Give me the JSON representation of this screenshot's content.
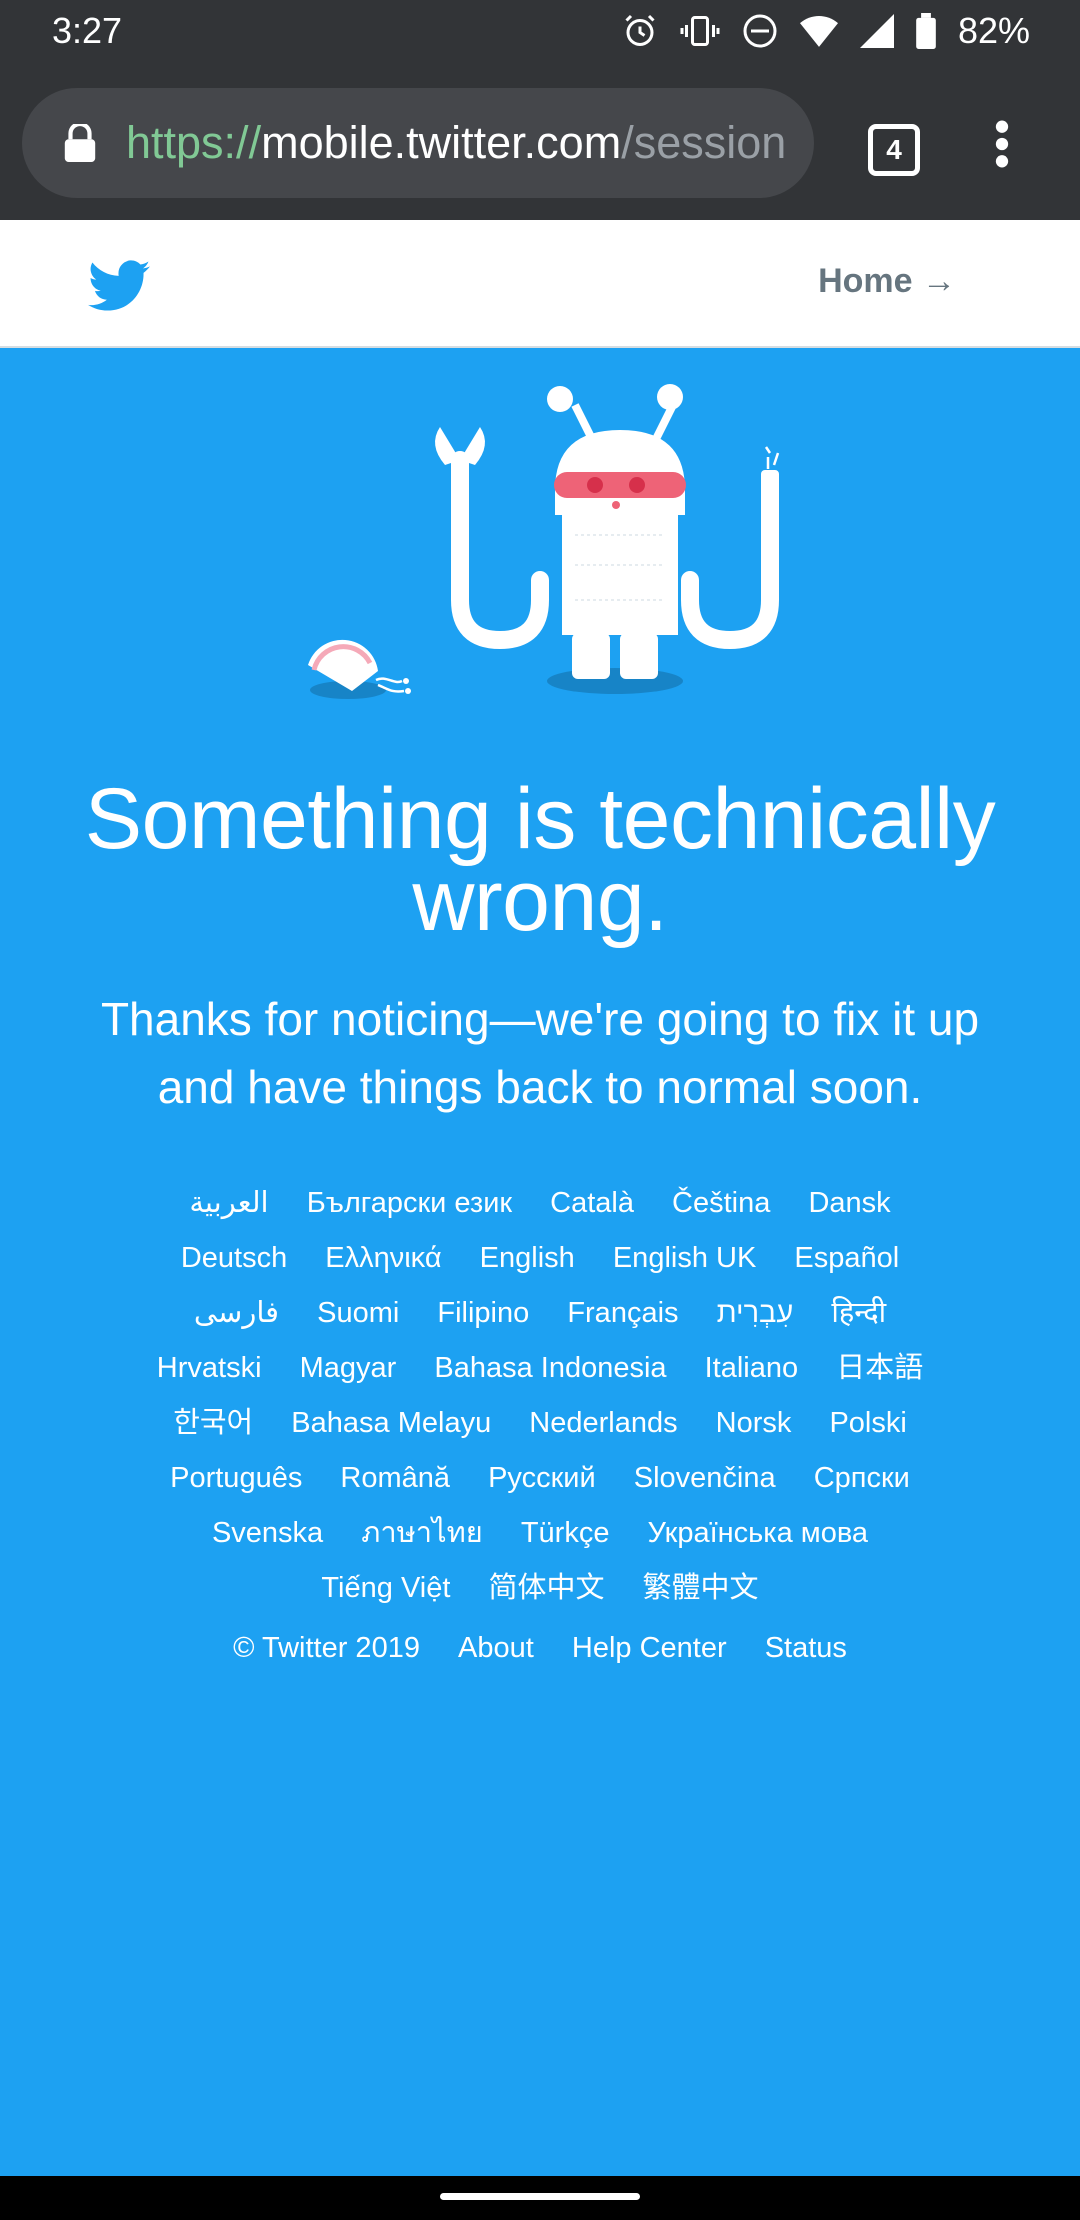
{
  "status_bar": {
    "time": "3:27",
    "battery": "82%"
  },
  "browser": {
    "url_scheme": "https://",
    "url_host": "mobile.twitter.com",
    "url_path": "/session",
    "tab_count": "4"
  },
  "header": {
    "home_link": "Home →"
  },
  "error": {
    "headline": "Something is technically wrong.",
    "message": "Thanks for noticing—we're going to fix it up and have things back to normal soon."
  },
  "languages": [
    "العربية",
    "Български език",
    "Català",
    "Čeština",
    "Dansk",
    "Deutsch",
    "Ελληνικά",
    "English",
    "English UK",
    "Español",
    "فارسی",
    "Suomi",
    "Filipino",
    "Français",
    "עִבְרִית",
    "हिन्दी",
    "Hrvatski",
    "Magyar",
    "Bahasa Indonesia",
    "Italiano",
    "日本語",
    "한국어",
    "Bahasa Melayu",
    "Nederlands",
    "Norsk",
    "Polski",
    "Português",
    "Română",
    "Русский",
    "Slovenčina",
    "Српски",
    "Svenska",
    "ภาษาไทย",
    "Türkçe",
    "Українська мова",
    "Tiếng Việt",
    "简体中文",
    "繁體中文"
  ],
  "footer": {
    "copyright": "© Twitter 2019",
    "about": "About",
    "help": "Help Center",
    "status": "Status"
  },
  "colors": {
    "page_bg": "#1da1f2",
    "brand_blue": "#1da1f2",
    "header_link": "#66757f"
  }
}
